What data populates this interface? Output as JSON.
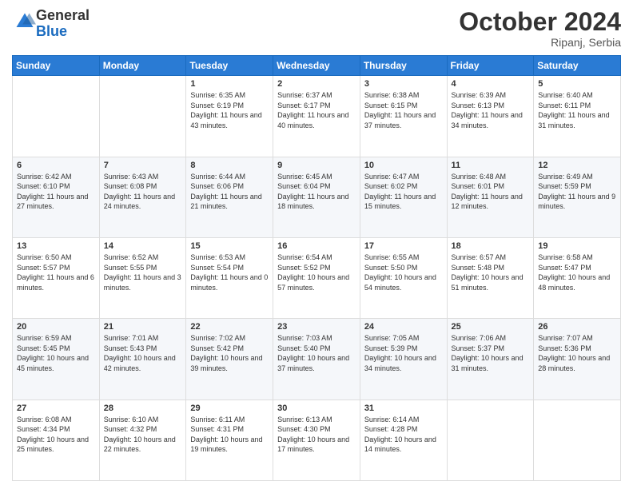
{
  "header": {
    "logo_line1": "General",
    "logo_line2": "Blue",
    "month": "October 2024",
    "location": "Ripanj, Serbia"
  },
  "weekdays": [
    "Sunday",
    "Monday",
    "Tuesday",
    "Wednesday",
    "Thursday",
    "Friday",
    "Saturday"
  ],
  "weeks": [
    [
      {
        "day": "",
        "text": ""
      },
      {
        "day": "",
        "text": ""
      },
      {
        "day": "1",
        "text": "Sunrise: 6:35 AM\nSunset: 6:19 PM\nDaylight: 11 hours and 43 minutes."
      },
      {
        "day": "2",
        "text": "Sunrise: 6:37 AM\nSunset: 6:17 PM\nDaylight: 11 hours and 40 minutes."
      },
      {
        "day": "3",
        "text": "Sunrise: 6:38 AM\nSunset: 6:15 PM\nDaylight: 11 hours and 37 minutes."
      },
      {
        "day": "4",
        "text": "Sunrise: 6:39 AM\nSunset: 6:13 PM\nDaylight: 11 hours and 34 minutes."
      },
      {
        "day": "5",
        "text": "Sunrise: 6:40 AM\nSunset: 6:11 PM\nDaylight: 11 hours and 31 minutes."
      }
    ],
    [
      {
        "day": "6",
        "text": "Sunrise: 6:42 AM\nSunset: 6:10 PM\nDaylight: 11 hours and 27 minutes."
      },
      {
        "day": "7",
        "text": "Sunrise: 6:43 AM\nSunset: 6:08 PM\nDaylight: 11 hours and 24 minutes."
      },
      {
        "day": "8",
        "text": "Sunrise: 6:44 AM\nSunset: 6:06 PM\nDaylight: 11 hours and 21 minutes."
      },
      {
        "day": "9",
        "text": "Sunrise: 6:45 AM\nSunset: 6:04 PM\nDaylight: 11 hours and 18 minutes."
      },
      {
        "day": "10",
        "text": "Sunrise: 6:47 AM\nSunset: 6:02 PM\nDaylight: 11 hours and 15 minutes."
      },
      {
        "day": "11",
        "text": "Sunrise: 6:48 AM\nSunset: 6:01 PM\nDaylight: 11 hours and 12 minutes."
      },
      {
        "day": "12",
        "text": "Sunrise: 6:49 AM\nSunset: 5:59 PM\nDaylight: 11 hours and 9 minutes."
      }
    ],
    [
      {
        "day": "13",
        "text": "Sunrise: 6:50 AM\nSunset: 5:57 PM\nDaylight: 11 hours and 6 minutes."
      },
      {
        "day": "14",
        "text": "Sunrise: 6:52 AM\nSunset: 5:55 PM\nDaylight: 11 hours and 3 minutes."
      },
      {
        "day": "15",
        "text": "Sunrise: 6:53 AM\nSunset: 5:54 PM\nDaylight: 11 hours and 0 minutes."
      },
      {
        "day": "16",
        "text": "Sunrise: 6:54 AM\nSunset: 5:52 PM\nDaylight: 10 hours and 57 minutes."
      },
      {
        "day": "17",
        "text": "Sunrise: 6:55 AM\nSunset: 5:50 PM\nDaylight: 10 hours and 54 minutes."
      },
      {
        "day": "18",
        "text": "Sunrise: 6:57 AM\nSunset: 5:48 PM\nDaylight: 10 hours and 51 minutes."
      },
      {
        "day": "19",
        "text": "Sunrise: 6:58 AM\nSunset: 5:47 PM\nDaylight: 10 hours and 48 minutes."
      }
    ],
    [
      {
        "day": "20",
        "text": "Sunrise: 6:59 AM\nSunset: 5:45 PM\nDaylight: 10 hours and 45 minutes."
      },
      {
        "day": "21",
        "text": "Sunrise: 7:01 AM\nSunset: 5:43 PM\nDaylight: 10 hours and 42 minutes."
      },
      {
        "day": "22",
        "text": "Sunrise: 7:02 AM\nSunset: 5:42 PM\nDaylight: 10 hours and 39 minutes."
      },
      {
        "day": "23",
        "text": "Sunrise: 7:03 AM\nSunset: 5:40 PM\nDaylight: 10 hours and 37 minutes."
      },
      {
        "day": "24",
        "text": "Sunrise: 7:05 AM\nSunset: 5:39 PM\nDaylight: 10 hours and 34 minutes."
      },
      {
        "day": "25",
        "text": "Sunrise: 7:06 AM\nSunset: 5:37 PM\nDaylight: 10 hours and 31 minutes."
      },
      {
        "day": "26",
        "text": "Sunrise: 7:07 AM\nSunset: 5:36 PM\nDaylight: 10 hours and 28 minutes."
      }
    ],
    [
      {
        "day": "27",
        "text": "Sunrise: 6:08 AM\nSunset: 4:34 PM\nDaylight: 10 hours and 25 minutes."
      },
      {
        "day": "28",
        "text": "Sunrise: 6:10 AM\nSunset: 4:32 PM\nDaylight: 10 hours and 22 minutes."
      },
      {
        "day": "29",
        "text": "Sunrise: 6:11 AM\nSunset: 4:31 PM\nDaylight: 10 hours and 19 minutes."
      },
      {
        "day": "30",
        "text": "Sunrise: 6:13 AM\nSunset: 4:30 PM\nDaylight: 10 hours and 17 minutes."
      },
      {
        "day": "31",
        "text": "Sunrise: 6:14 AM\nSunset: 4:28 PM\nDaylight: 10 hours and 14 minutes."
      },
      {
        "day": "",
        "text": ""
      },
      {
        "day": "",
        "text": ""
      }
    ]
  ]
}
